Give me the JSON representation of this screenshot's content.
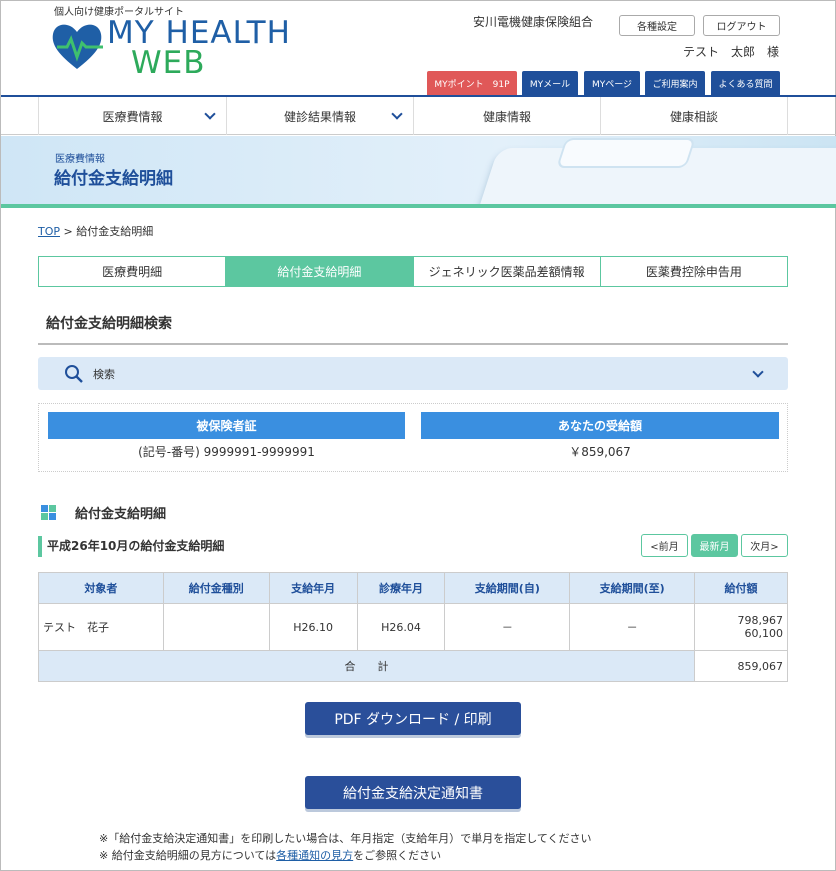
{
  "header": {
    "tagline": "個人向け健康ポータルサイト",
    "logo_line1": "MY HEALTH",
    "logo_line2": "WEB",
    "org_name": "安川電機健康保険組合",
    "settings_label": "各種設定",
    "logout_label": "ログアウト",
    "user_name": "テスト　太郎　様",
    "pills": [
      {
        "label": "MYポイント　91P",
        "color": "#e05858"
      },
      {
        "label": "MYメール",
        "color": "#1f4f9a"
      },
      {
        "label": "MYページ",
        "color": "#1f4f9a"
      },
      {
        "label": "ご利用案内",
        "color": "#1f4f9a"
      },
      {
        "label": "よくある質問",
        "color": "#1f4f9a"
      }
    ]
  },
  "nav": {
    "items": [
      {
        "label": "医療費情報",
        "has_dropdown": true
      },
      {
        "label": "健診結果情報",
        "has_dropdown": true
      },
      {
        "label": "健康情報",
        "has_dropdown": false
      },
      {
        "label": "健康相談",
        "has_dropdown": false
      }
    ]
  },
  "banner": {
    "subtitle": "医療費情報",
    "title": "給付金支給明細"
  },
  "breadcrumb": {
    "home": "TOP",
    "separator": " > ",
    "current": "給付金支給明細"
  },
  "tabs": [
    {
      "label": "医療費明細",
      "active": false
    },
    {
      "label": "給付金支給明細",
      "active": true
    },
    {
      "label": "ジェネリック医薬品差額情報",
      "active": false
    },
    {
      "label": "医薬費控除申告用",
      "active": false
    }
  ],
  "search_section": {
    "title": "給付金支給明細検索",
    "search_label": "検索"
  },
  "info": {
    "insured_header": "被保険者証",
    "insured_value": "(記号-番号) 9999991-9999991",
    "amount_header": "あなたの受給額",
    "amount_value": "￥859,067"
  },
  "detail": {
    "title": "給付金支給明細",
    "month_title": "平成26年10月の給付金支給明細",
    "prev_label": "<前月",
    "latest_label": "最新月",
    "next_label": "次月>"
  },
  "table": {
    "headers": [
      "対象者",
      "給付金種別",
      "支給年月",
      "診療年月",
      "支給期間(自)",
      "支給期間(至)",
      "給付額"
    ],
    "rows": [
      {
        "person": "テスト　花子",
        "type": "",
        "pay_month": "H26.10",
        "treat_month": "H26.04",
        "from": "－",
        "to": "－",
        "amount1": "798,967",
        "amount2": "60,100"
      }
    ],
    "total_label": "合　　計",
    "total_value": "859,067"
  },
  "buttons": {
    "pdf": "PDF ダウンロード / 印刷",
    "notice": "給付金支給決定通知書"
  },
  "notes": {
    "note1": "※「給付金支給決定通知書」を印刷したい場合は、年月指定（支給年月）で単月を指定してください",
    "note2_prefix": "※ 給付金支給明細の見方については",
    "note2_link": "各種通知の見方",
    "note2_suffix": "をご参照ください"
  },
  "colors": {
    "brand_blue": "#1f4f9a",
    "accent_green": "#5cc7a0",
    "header_blue": "#3a8fe0",
    "point_red": "#e05858"
  }
}
